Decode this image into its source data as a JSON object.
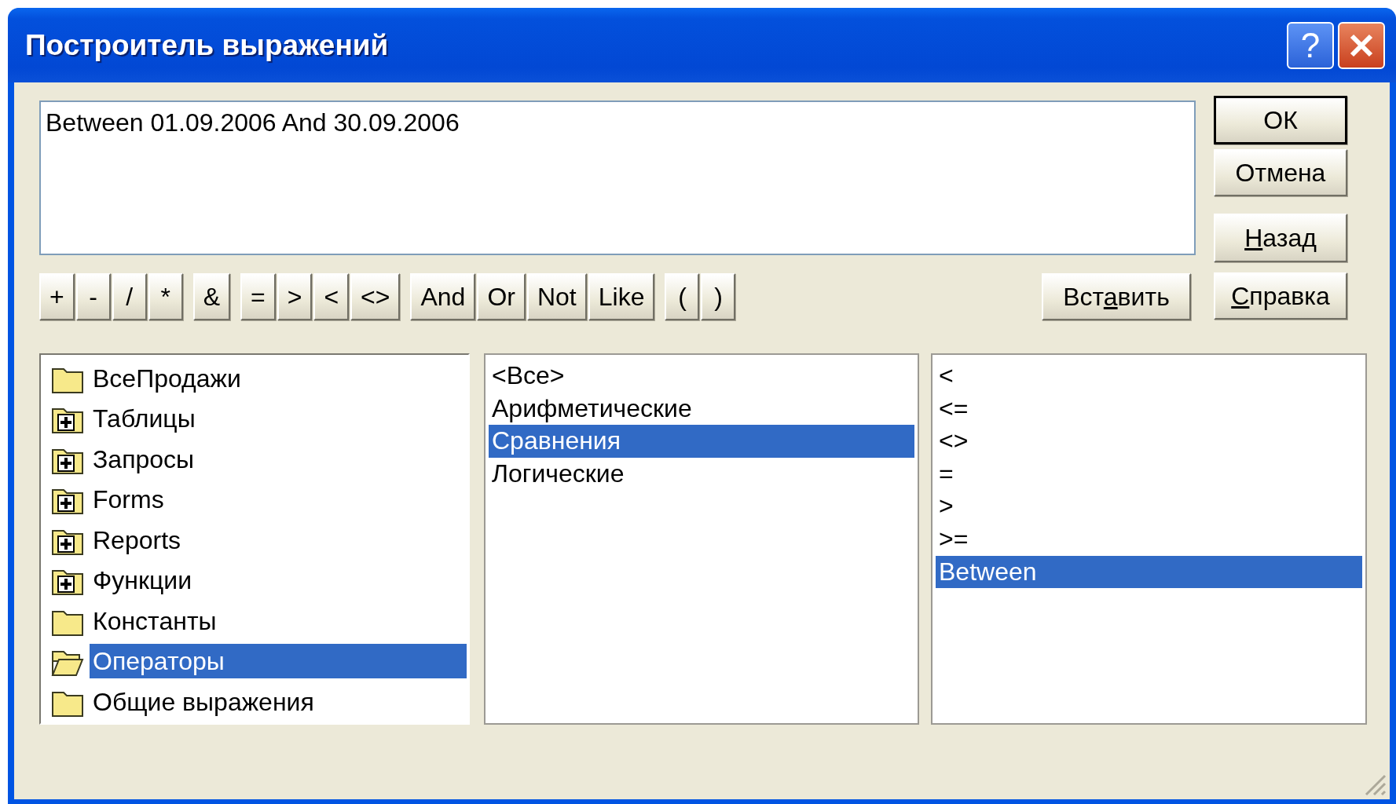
{
  "window": {
    "title": "Построитель выражений",
    "help_button": "?"
  },
  "expression": {
    "value": "Between 01.09.2006 And 30.09.2006"
  },
  "dialog_buttons": [
    {
      "label": {
        "before": "ОК"
      },
      "default": true
    },
    {
      "label": {
        "before": "Отмена"
      },
      "default": false
    },
    {
      "label": {
        "key": "Н",
        "after": "азад"
      },
      "default": false
    }
  ],
  "operator_groups": [
    [
      "+",
      "-",
      "/",
      "*"
    ],
    [
      "&"
    ],
    [
      "=",
      ">",
      "<",
      "<>"
    ],
    [
      "And",
      "Or",
      "Not",
      "Like"
    ],
    [
      "(",
      ")"
    ]
  ],
  "paste_button": {
    "label": {
      "before": "Вст",
      "key": "а",
      "after": "вить"
    }
  },
  "help_dialog_button": {
    "label": {
      "key": "С",
      "after": "правка"
    }
  },
  "tree": [
    {
      "label": "ВсеПродажи",
      "kind": "folder",
      "selected": false
    },
    {
      "label": "Таблицы",
      "kind": "expandable",
      "selected": false
    },
    {
      "label": "Запросы",
      "kind": "expandable",
      "selected": false
    },
    {
      "label": "Forms",
      "kind": "expandable",
      "selected": false
    },
    {
      "label": "Reports",
      "kind": "expandable",
      "selected": false
    },
    {
      "label": "Функции",
      "kind": "expandable",
      "selected": false
    },
    {
      "label": "Константы",
      "kind": "folder",
      "selected": false
    },
    {
      "label": "Операторы",
      "kind": "open",
      "selected": true
    },
    {
      "label": "Общие выражения",
      "kind": "folder",
      "selected": false
    }
  ],
  "categories": [
    {
      "label": "<Все>",
      "selected": false
    },
    {
      "label": "Арифметические",
      "selected": false
    },
    {
      "label": "Сравнения",
      "selected": true
    },
    {
      "label": "Логические",
      "selected": false
    }
  ],
  "operators": [
    {
      "label": "<",
      "selected": false
    },
    {
      "label": "<=",
      "selected": false
    },
    {
      "label": "<>",
      "selected": false
    },
    {
      "label": "=",
      "selected": false
    },
    {
      "label": ">",
      "selected": false
    },
    {
      "label": ">=",
      "selected": false
    },
    {
      "label": "Between",
      "selected": true
    }
  ]
}
